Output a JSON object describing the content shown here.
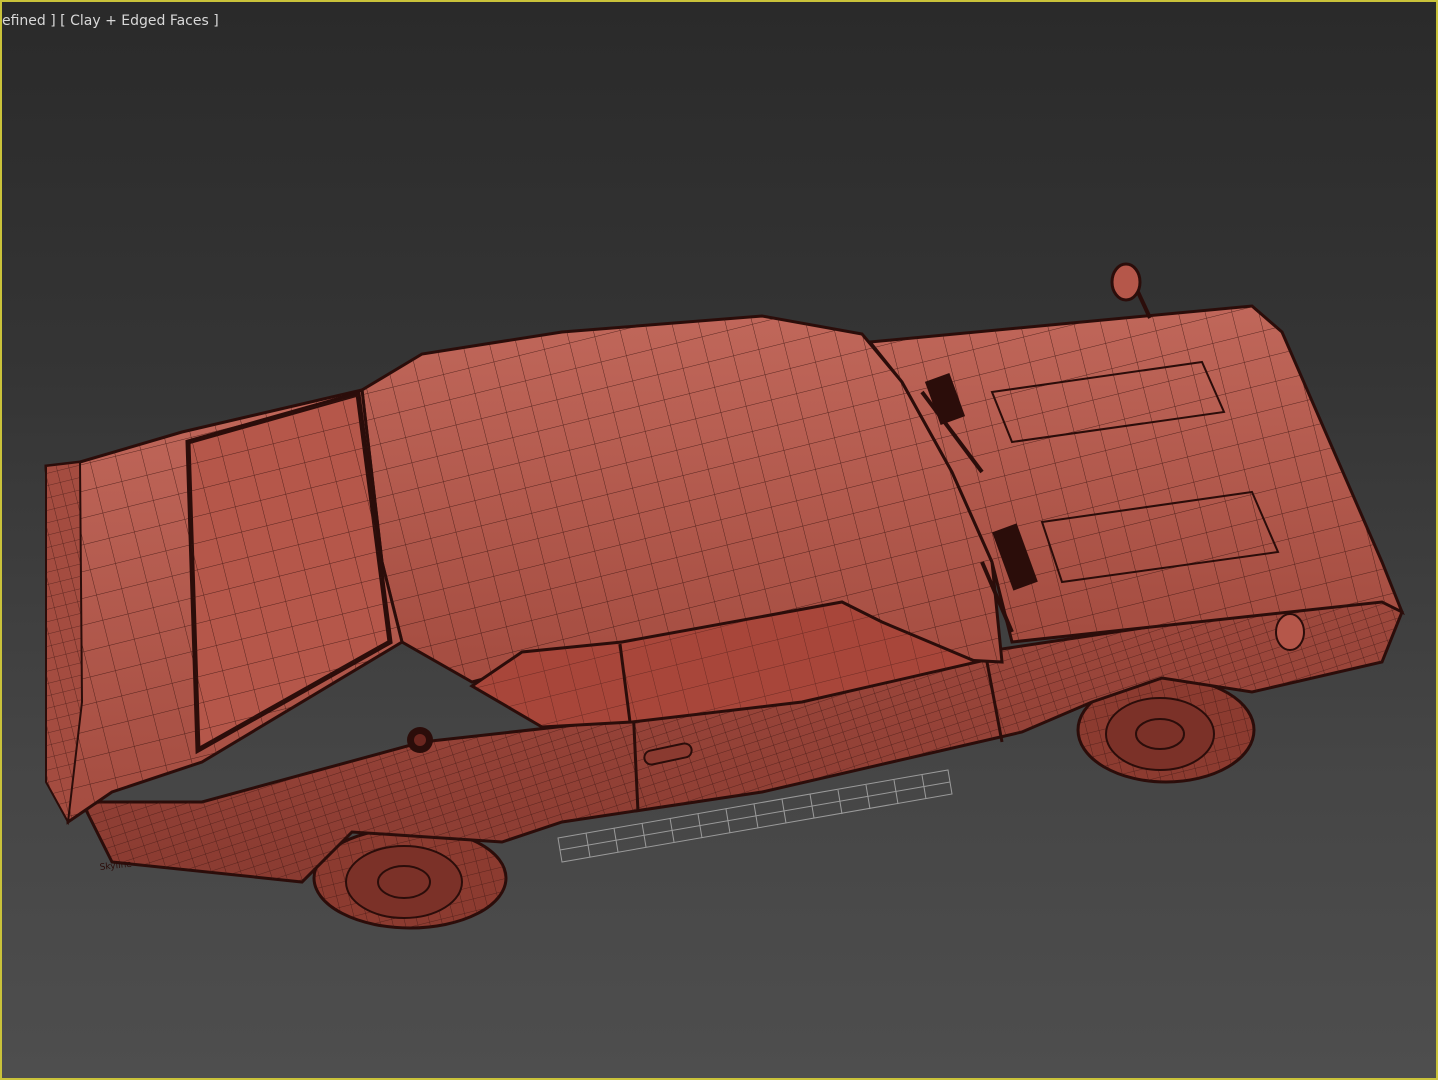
{
  "viewport": {
    "label_view": "efined ]",
    "label_shading": "[ Clay + Edged Faces ]",
    "border_color": "#c9c23a",
    "clay_color": "#b5574a",
    "wire_color": "#3a1410"
  },
  "model": {
    "badge_text": "Skyline"
  }
}
